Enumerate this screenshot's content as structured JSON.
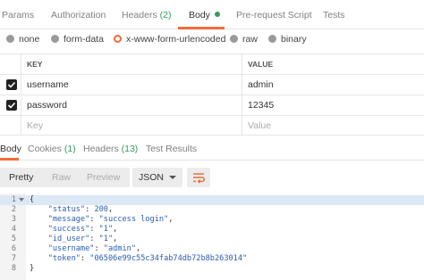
{
  "request_tabs": [
    {
      "label": "Params",
      "count": ""
    },
    {
      "label": "Authorization",
      "count": ""
    },
    {
      "label": "Headers",
      "count": "(2)"
    },
    {
      "label": "Body",
      "count": ""
    },
    {
      "label": "Pre-request Script",
      "count": ""
    },
    {
      "label": "Tests",
      "count": ""
    }
  ],
  "active_request_tab": "Body",
  "body_types": [
    "none",
    "form-data",
    "x-www-form-urlencoded",
    "raw",
    "binary"
  ],
  "selected_body_type": "x-www-form-urlencoded",
  "params_table": {
    "headers": {
      "key": "KEY",
      "value": "VALUE"
    },
    "rows": [
      {
        "checked": true,
        "key": "username",
        "value": "admin"
      },
      {
        "checked": true,
        "key": "password",
        "value": "12345"
      }
    ],
    "placeholder": {
      "key": "Key",
      "value": "Value"
    }
  },
  "response_tabs": [
    {
      "label": "Body",
      "count": ""
    },
    {
      "label": "Cookies",
      "count": "(1)"
    },
    {
      "label": "Headers",
      "count": "(13)"
    },
    {
      "label": "Test Results",
      "count": ""
    }
  ],
  "active_response_tab": "Body",
  "view_modes": [
    "Pretty",
    "Raw",
    "Preview"
  ],
  "active_view_mode": "Pretty",
  "format_select": "JSON",
  "response_lines": [
    {
      "num": "1",
      "fold": true,
      "parts": [
        [
          "p",
          "{"
        ]
      ]
    },
    {
      "num": "2",
      "parts": [
        [
          "k",
          "    \"status\""
        ],
        [
          "p",
          ": "
        ],
        [
          "n",
          "200"
        ],
        [
          "p",
          ","
        ]
      ]
    },
    {
      "num": "3",
      "parts": [
        [
          "k",
          "    \"message\""
        ],
        [
          "p",
          ": "
        ],
        [
          "s",
          "\"success login\""
        ],
        [
          "p",
          ","
        ]
      ]
    },
    {
      "num": "4",
      "parts": [
        [
          "k",
          "    \"success\""
        ],
        [
          "p",
          ": "
        ],
        [
          "s",
          "\"1\""
        ],
        [
          "p",
          ","
        ]
      ]
    },
    {
      "num": "5",
      "parts": [
        [
          "k",
          "    \"id_user\""
        ],
        [
          "p",
          ": "
        ],
        [
          "s",
          "\"1\""
        ],
        [
          "p",
          ","
        ]
      ]
    },
    {
      "num": "6",
      "parts": [
        [
          "k",
          "    \"username\""
        ],
        [
          "p",
          ": "
        ],
        [
          "s",
          "\"admin\""
        ],
        [
          "p",
          ","
        ]
      ]
    },
    {
      "num": "7",
      "parts": [
        [
          "k",
          "    \"token\""
        ],
        [
          "p",
          ": "
        ],
        [
          "s",
          "\"06506e99c55c34fab74db72b8b263014\""
        ]
      ]
    },
    {
      "num": "8",
      "parts": [
        [
          "p",
          "}"
        ]
      ]
    }
  ],
  "colors": {
    "accent": "#f26b3a",
    "count_green": "#2d9f5c",
    "json_blue": "#2a5db0",
    "line_highlight": "#dde8f6"
  },
  "icons": {
    "checkbox": "check-icon",
    "wrap": "wrap-lines-icon",
    "dropdown": "chevron-down-icon"
  }
}
